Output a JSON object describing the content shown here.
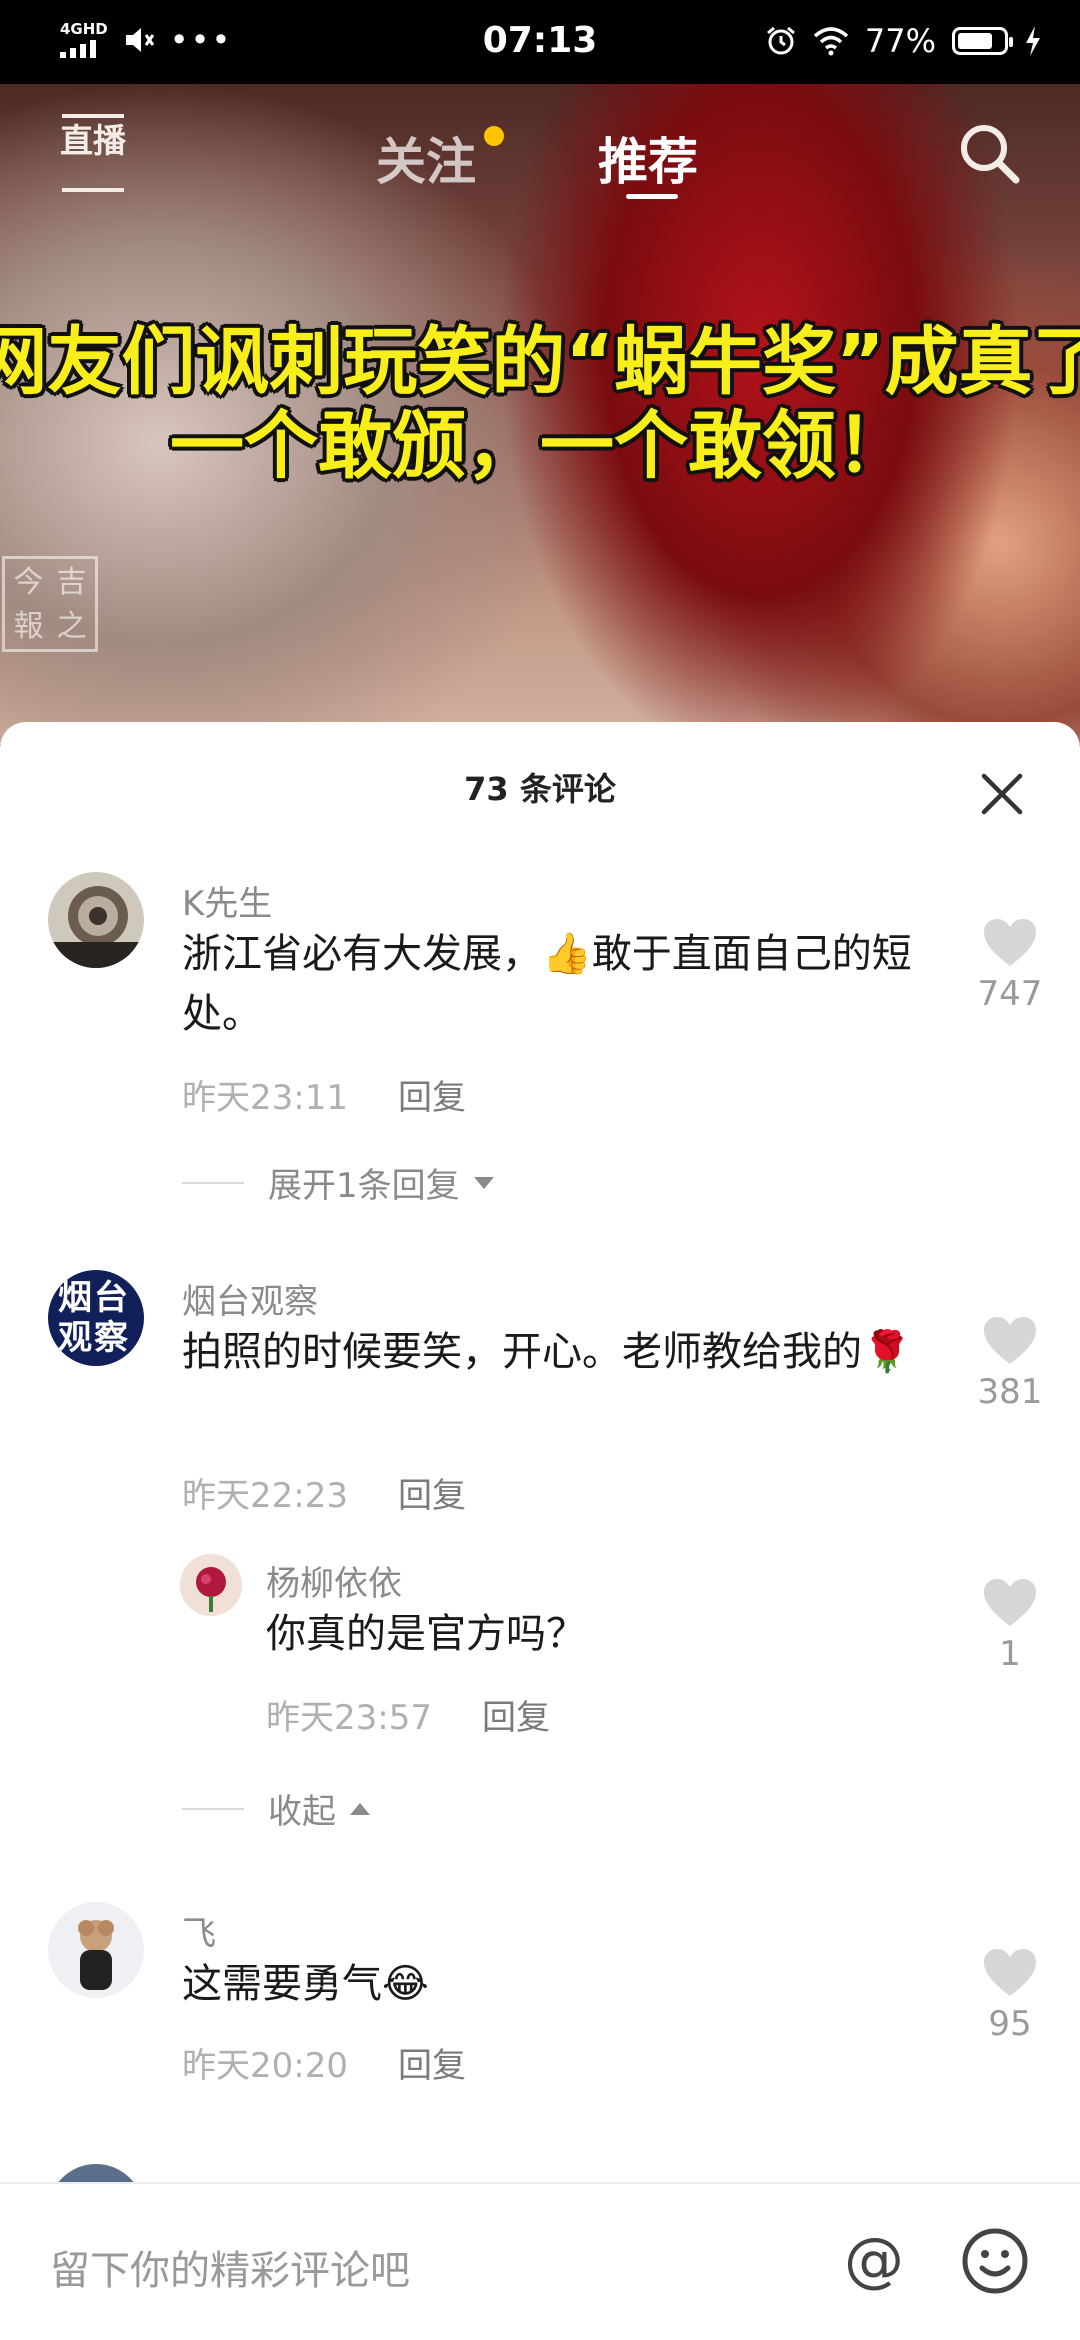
{
  "status_bar": {
    "network": "4GHD",
    "time": "07:13",
    "battery": "77%",
    "battery_level": 0.77,
    "icons": [
      "signal-icon",
      "mute-icon",
      "more-dots-icon",
      "alarm-icon",
      "wifi-icon",
      "battery-icon",
      "charging-icon"
    ]
  },
  "top_nav": {
    "live": "直播",
    "tabs": [
      {
        "label": "关注",
        "has_badge": true
      },
      {
        "label": "推荐",
        "active": true
      }
    ],
    "badge_color": "#ffc300"
  },
  "video": {
    "caption_line1": "网友们讽刺玩笑的“蜗牛奖”成真了",
    "caption_line2": "一个敢颁，一个敢领！",
    "caption_color": "#f8ef1a"
  },
  "comments_panel": {
    "title": "73 条评论",
    "comments": [
      {
        "user": "K先生",
        "text": "浙江省必有大发展，👍敢于直面自己的短处。",
        "time": "昨天23:11",
        "reply_label": "回复",
        "likes": "747",
        "expand_label": "展开1条回复"
      },
      {
        "user": "烟台观察",
        "avatar_text": "烟台观察",
        "text": "拍照的时候要笑，开心。老师教给我的🌹",
        "time": "昨天22:23",
        "reply_label": "回复",
        "likes": "381",
        "replies": [
          {
            "user": "杨柳依依",
            "text": "你真的是官方吗？",
            "time": "昨天23:57",
            "reply_label": "回复",
            "likes": "1"
          }
        ],
        "collapse_label": "收起"
      },
      {
        "user": "飞",
        "text": "这需要勇气😂",
        "time": "昨天20:20",
        "reply_label": "回复",
        "likes": "95"
      }
    ]
  },
  "input_bar": {
    "placeholder": "留下你的精彩评论吧",
    "at_symbol": "@"
  }
}
